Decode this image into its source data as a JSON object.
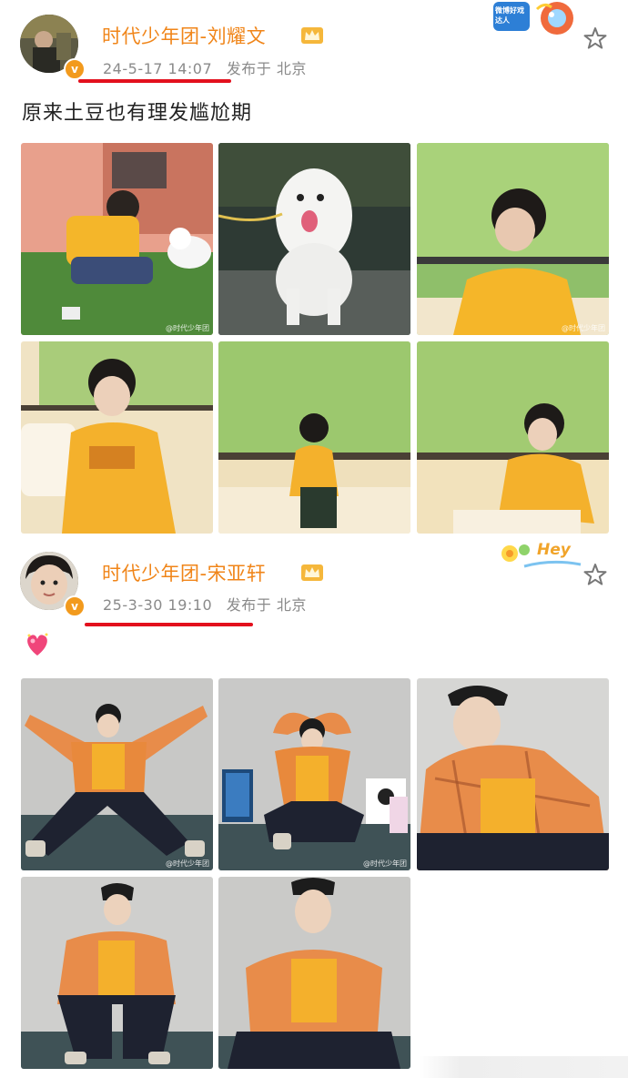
{
  "posts": [
    {
      "username": "时代少年团-刘耀文",
      "date": "24-5-17 14:07",
      "location": "发布于 北京",
      "text": "原来土豆也有理发尴尬期",
      "watermark": "@时代少年团"
    },
    {
      "username": "时代少年团-宋亚轩",
      "date": "25-3-30 19:10",
      "location": "发布于 北京",
      "text": "",
      "watermark": "@时代少年团"
    }
  ],
  "stickers": {
    "top_right_label": "微博好戏达人",
    "mid_right_label": "Hey"
  },
  "colors": {
    "username": "#f08519",
    "meta": "#8a8a8a",
    "underline": "#e3101d",
    "badge": "#f29a1d"
  }
}
